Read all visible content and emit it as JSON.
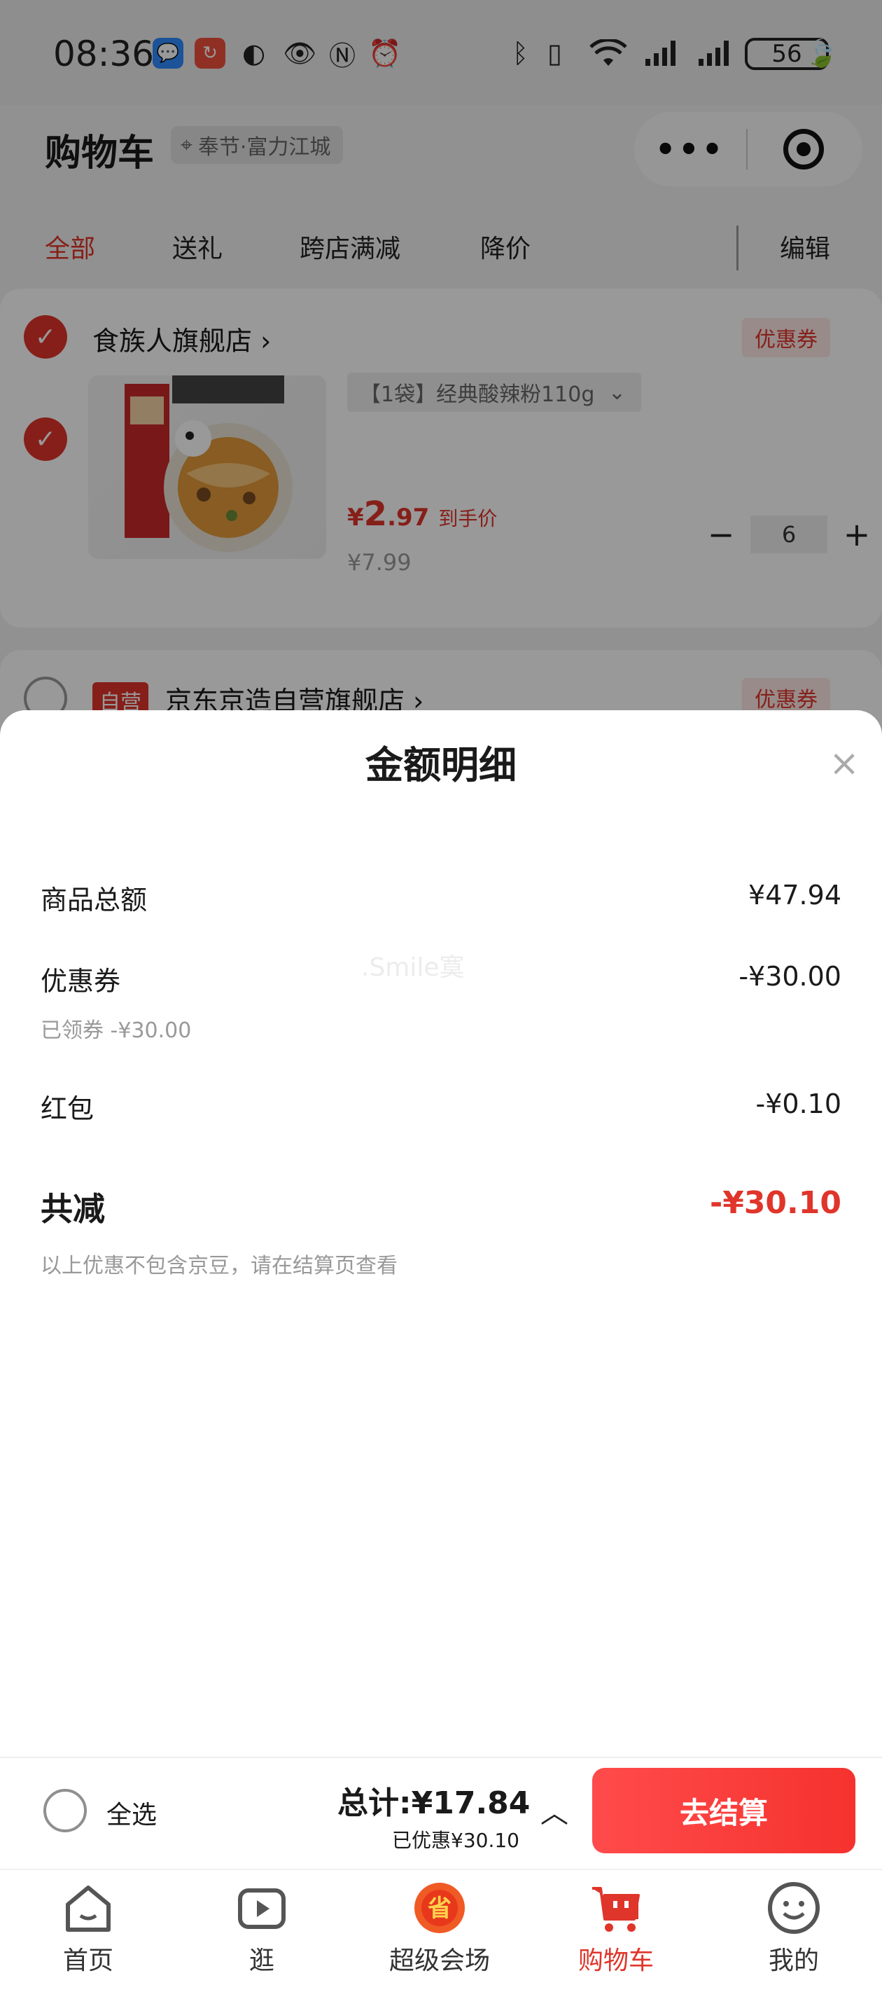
{
  "status_bar": {
    "time": "08:36",
    "battery": "56",
    "icons": [
      "message-icon",
      "app-badge-icon",
      "data-saver-icon",
      "eye-icon",
      "nfc-icon",
      "alarm-icon",
      "bluetooth-icon",
      "vibrate-icon",
      "wifi-icon",
      "signal-icon",
      "signal-icon",
      "leaf-icon"
    ]
  },
  "header": {
    "title": "购物车",
    "location": "奉节·富力江城",
    "capsule_more": "•••"
  },
  "tabs": [
    {
      "label": "全部",
      "active": true
    },
    {
      "label": "送礼"
    },
    {
      "label": "跨店满减"
    },
    {
      "label": "降价"
    },
    {
      "label": "编辑"
    }
  ],
  "stores": [
    {
      "name": "食族人旗舰店",
      "coupon": "优惠券",
      "checked": true,
      "item": {
        "spec": "【1袋】经典酸辣粉110g",
        "price_symbol": "¥",
        "price_int": "2",
        "price_dec": ".97",
        "price_tag": "到手价",
        "original_price": "¥7.99",
        "quantity": "6"
      }
    },
    {
      "badge": "自营",
      "name": "京东京造自营旗舰店",
      "coupon": "优惠券",
      "checked": false
    }
  ],
  "sheet": {
    "title": "金额明细",
    "rows": [
      {
        "label": "商品总额",
        "value": "¥47.94"
      },
      {
        "label": "优惠券",
        "value": "-¥30.00",
        "sub": "已领券 -¥30.00"
      },
      {
        "label": "红包",
        "value": "-¥0.10"
      }
    ],
    "total": {
      "label": "共减",
      "value": "-¥30.10",
      "note": "以上优惠不包含京豆，请在结算页查看"
    },
    "watermark": ".Smile寞"
  },
  "checkout": {
    "select_all": "全选",
    "total": "总计:¥17.84",
    "saved": "已优惠¥30.10",
    "button": "去结算"
  },
  "nav": [
    {
      "label": "首页",
      "icon": "home-icon"
    },
    {
      "label": "逛",
      "icon": "video-play-icon"
    },
    {
      "label": "超级会场",
      "icon": "super-venue-icon"
    },
    {
      "label": "购物车",
      "icon": "cart-icon",
      "active": true
    },
    {
      "label": "我的",
      "icon": "profile-icon"
    }
  ],
  "colors": {
    "accent": "#e0352b",
    "overlay": "rgba(0,0,0,0.40)",
    "checkout_gradient_start": "#ff4b4b",
    "checkout_gradient_end": "#f5322e"
  }
}
